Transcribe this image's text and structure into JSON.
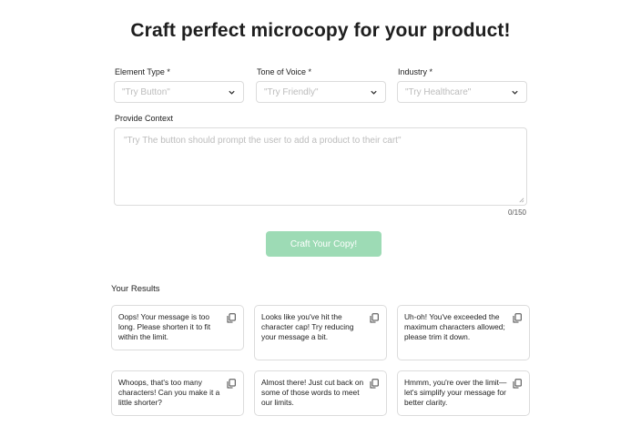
{
  "page": {
    "title": "Craft perfect microcopy for your product!"
  },
  "form": {
    "element_type": {
      "label": "Element Type *",
      "placeholder": "\"Try Button\""
    },
    "tone_of_voice": {
      "label": "Tone of Voice *",
      "placeholder": "\"Try Friendly\""
    },
    "industry": {
      "label": "Industry *",
      "placeholder": "\"Try Healthcare\""
    },
    "context": {
      "label": "Provide Context",
      "placeholder": "\"Try The button should prompt the user to add a product to their cart\"",
      "counter": "0/150"
    },
    "submit_label": "Craft Your Copy!"
  },
  "results": {
    "heading": "Your Results",
    "items": [
      "Oops! Your message is too long. Please shorten it to fit within the limit.",
      "Looks like you've hit the character cap! Try reducing your message a bit.",
      "Uh-oh! You've exceeded the maximum characters allowed; please trim it down.",
      "Whoops, that's too many characters! Can you make it a little shorter?",
      "Almost there! Just cut back on some of those words to meet our limits.",
      "Hmmm, you're over the limit—let's simplify your message for better clarity."
    ]
  },
  "icons": {
    "select_arrow": "chevron-down-icon",
    "copy": "copy-icon",
    "resize": "resize-handle-icon"
  },
  "colors": {
    "button_bg": "#9ddbb5",
    "border": "#dcdcdc",
    "placeholder": "#bcbcbc"
  }
}
